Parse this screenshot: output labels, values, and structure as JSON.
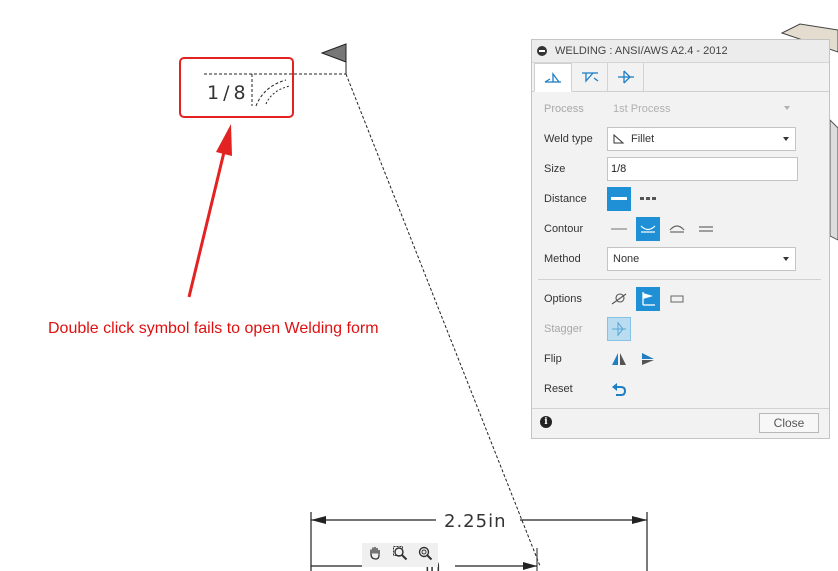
{
  "drawing": {
    "weld_size_text": "1/8",
    "dimension_main": "2.25in",
    "dimension_partial": "in"
  },
  "annotation": {
    "text": "Double click symbol fails to open Welding form",
    "color": "#e01010"
  },
  "panel": {
    "title": "WELDING : ANSI/AWS A2.4 - 2012",
    "tabs": [
      {
        "icon": "arrow-side-weld-icon",
        "active": true
      },
      {
        "icon": "other-side-weld-icon",
        "active": false
      },
      {
        "icon": "both-sides-weld-icon",
        "active": false
      }
    ],
    "process": {
      "label": "Process",
      "value": "1st Process"
    },
    "weld_type": {
      "label": "Weld type",
      "value": "Fillet"
    },
    "size": {
      "label": "Size",
      "value": "1/8"
    },
    "distance": {
      "label": "Distance"
    },
    "contour": {
      "label": "Contour"
    },
    "method": {
      "label": "Method",
      "value": "None"
    },
    "options": {
      "label": "Options"
    },
    "stagger": {
      "label": "Stagger"
    },
    "flip": {
      "label": "Flip"
    },
    "reset": {
      "label": "Reset"
    },
    "close_label": "Close",
    "accent_color": "#1f90d6"
  },
  "navigation_tools": [
    "pan-icon",
    "zoom-window-icon",
    "zoom-icon"
  ]
}
